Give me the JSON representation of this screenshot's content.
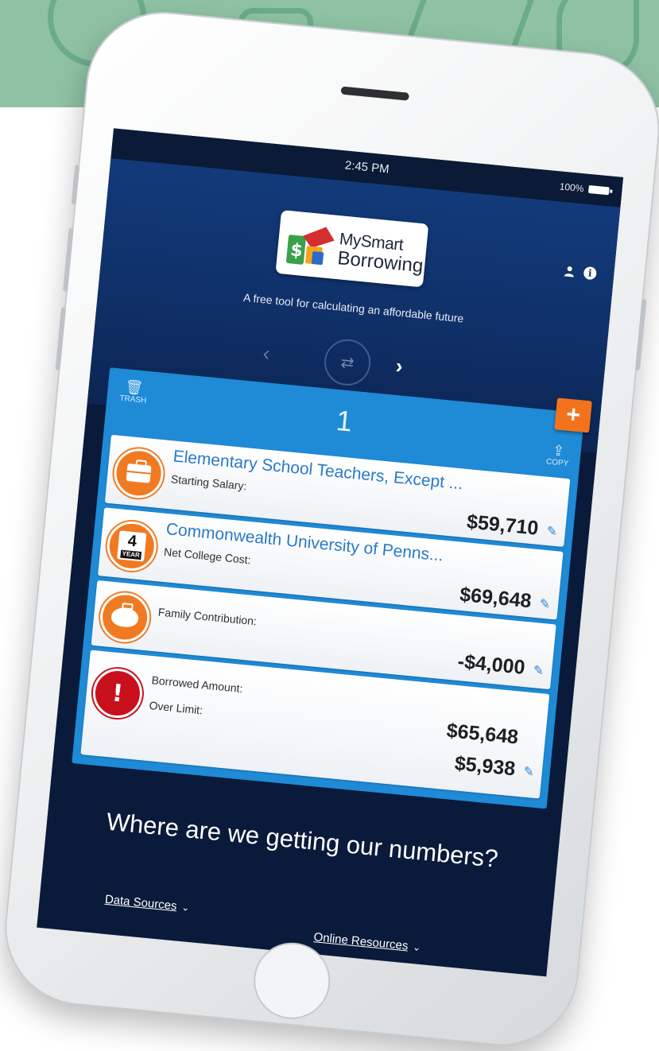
{
  "status_bar": {
    "time": "2:45 PM",
    "battery": "100%"
  },
  "app": {
    "logo_line1": "MySmart",
    "logo_line2": "Borrowing",
    "tagline": "A free tool for calculating an affordable future"
  },
  "nav": {
    "prev": "‹",
    "next": "›",
    "center_icon": "⇄"
  },
  "panel": {
    "number": "1",
    "trash_label": "TRASH",
    "copy_label": "COPY",
    "add_label": "+"
  },
  "cards": [
    {
      "title": "Elementary School Teachers, Except ...",
      "label": "Starting Salary:",
      "value": "$59,710",
      "icon": "briefcase-icon"
    },
    {
      "title": "Commonwealth University of Penns...",
      "label": "Net College Cost:",
      "value": "$69,648",
      "icon": "four-year-college-icon",
      "badge_number": "4",
      "badge_text": "YEAR"
    },
    {
      "label": "Family Contribution:",
      "value": "-$4,000",
      "icon": "piggy-bank-icon"
    },
    {
      "label": "Borrowed Amount:",
      "label2": "Over Limit:",
      "value": "$65,648",
      "value2": "$5,938",
      "icon": "alert-icon"
    }
  ],
  "footer": {
    "question": "Where are we getting our numbers?",
    "data_sources": "Data Sources",
    "online_resources": "Online Resources"
  },
  "colors": {
    "accent_blue": "#1f8ad6",
    "orange": "#f2731c",
    "alert_red": "#c8101d",
    "navy": "#0a1a3a"
  }
}
